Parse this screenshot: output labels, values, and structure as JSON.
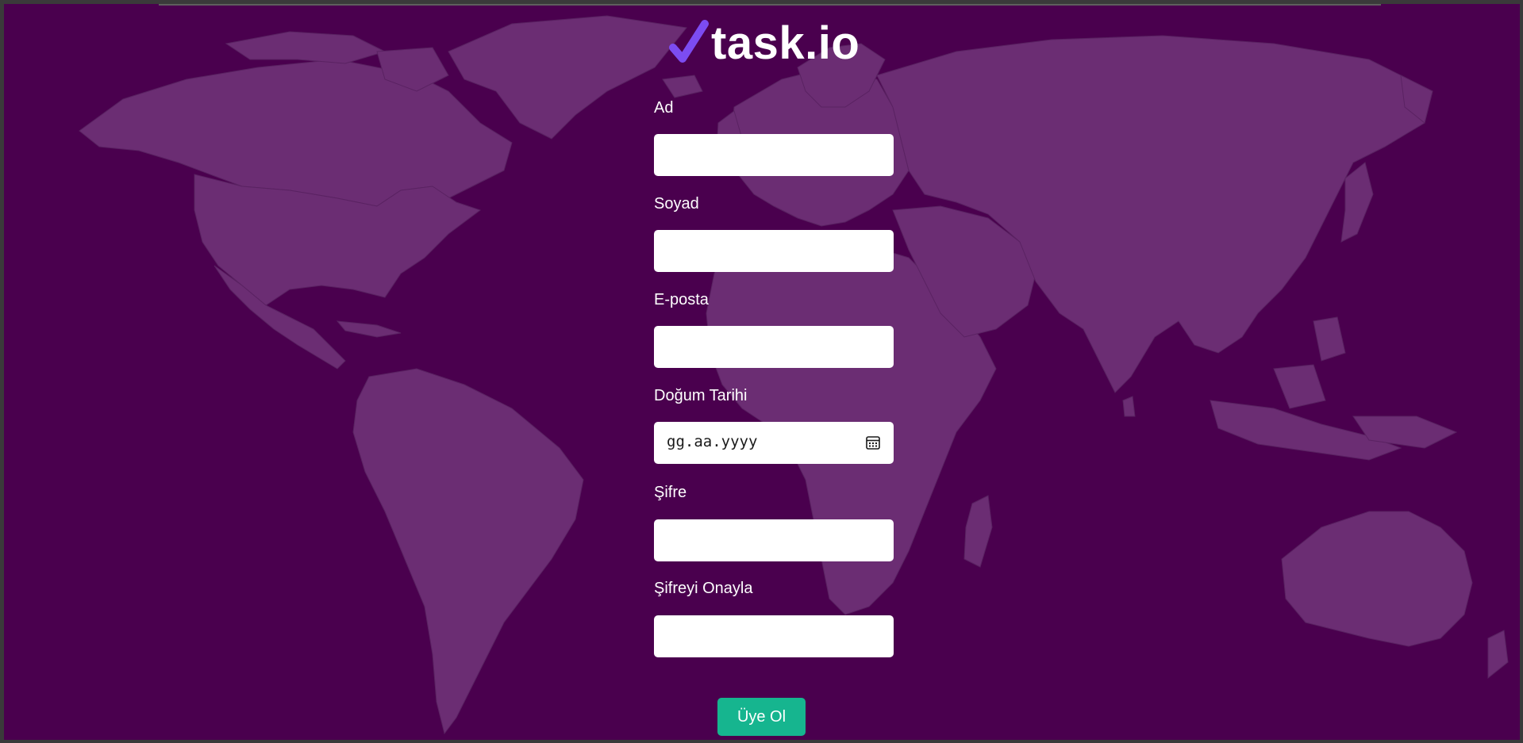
{
  "brand": {
    "name": "task.io",
    "check_icon": "checkmark-icon",
    "accent": "#7c4cf2"
  },
  "background": {
    "color": "#4a004e",
    "map_color": "#6b2d73",
    "map": "world-map"
  },
  "form": {
    "fields": [
      {
        "label": "Ad",
        "value": ""
      },
      {
        "label": "Soyad",
        "value": ""
      },
      {
        "label": "E-posta",
        "value": ""
      },
      {
        "label": "Doğum Tarihi",
        "value": "gg.aa.yyyy",
        "icon": "calendar-icon"
      },
      {
        "label": "Şifre",
        "value": ""
      },
      {
        "label": "Şifreyi Onayla",
        "value": ""
      }
    ],
    "submit_label": "Üye Ol",
    "submit_color": "#16b58f"
  }
}
